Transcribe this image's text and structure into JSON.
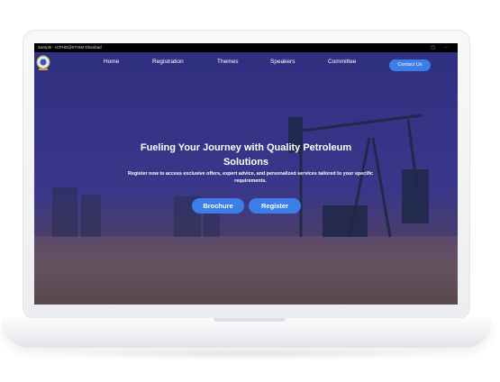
{
  "window": {
    "title": "Sample - ICPHD@IITISM Dhanbad",
    "icons": [
      "window-icon",
      "more-options-icon"
    ]
  },
  "nav": {
    "items": [
      "Home",
      "Registration",
      "Themes",
      "Speakers",
      "Committee"
    ],
    "contact_label": "Contact Us",
    "accent_color": "#3b7ee8"
  },
  "hero": {
    "headline": "Fueling Your Journey with Quality Petroleum Solutions",
    "subtext": "Register now to access exclusive offers, expert advice, and personalized services tailored to your specific requirements.",
    "buttons": [
      "Brochure",
      "Register"
    ]
  }
}
